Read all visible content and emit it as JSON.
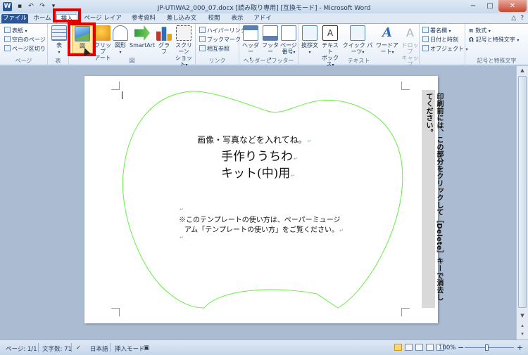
{
  "window": {
    "title": "JP-UTIWA2_000_07.docx [読み取り専用] [互換モード] - Microsoft Word",
    "app_icon": "W",
    "min": "−",
    "max": "□",
    "close": "✕"
  },
  "tabs": [
    {
      "label": "ファイル"
    },
    {
      "label": "ホーム"
    },
    {
      "label": "挿入"
    },
    {
      "label": "ページ レイアウト"
    },
    {
      "label": "参考資料"
    },
    {
      "label": "差し込み文書"
    },
    {
      "label": "校閲"
    },
    {
      "label": "表示"
    },
    {
      "label": "アドイン"
    }
  ],
  "ribbon": {
    "page_group": {
      "label": "ページ",
      "cover": "表紙",
      "blank": "空白のページ",
      "break": "ページ区切り"
    },
    "table_group": {
      "label": "表",
      "table": "表"
    },
    "figure_group": {
      "label": "図",
      "picture": "図",
      "clipart_1": "クリップ",
      "clipart_2": "アート",
      "shapes": "図形",
      "smartart": "SmartArt",
      "chart": "グラフ",
      "screenshot_1": "スクリーン",
      "screenshot_2": "ショット"
    },
    "link_group": {
      "label": "リンク",
      "hyperlink": "ハイパーリンク",
      "bookmark": "ブックマーク",
      "crossref": "相互参照"
    },
    "header_group": {
      "label": "ヘッダーとフッター",
      "header": "ヘッダー",
      "footer": "フッター",
      "pagenum_1": "ページ",
      "pagenum_2": "番号"
    },
    "text_group": {
      "label": "テキスト",
      "comment_1": "挨拶文",
      "textbox_1": "テキスト",
      "textbox_2": "ボックス",
      "quickparts": "クイック パーツ",
      "wordart": "ワードアート",
      "dropcap_1": "ドロップ",
      "dropcap_2": "キャップ",
      "signature": "署名欄",
      "datetime": "日付と時刻",
      "object": "オブジェクト"
    },
    "symbol_group": {
      "label": "記号と特殊文字",
      "equation": "数式",
      "symbol": "記号と特殊文字"
    }
  },
  "document": {
    "line1": "画像・写真などを入れてね。",
    "line2": "手作りうちわ",
    "line3": "キット(中)用",
    "note1": "※このテンプレートの使い方は、ペーパーミュージ",
    "note2": "アム「テンプレートの使い方」をご覧ください。",
    "side_note": "印刷前には、この部分をクリックして［Delete］キーで消去してください。",
    "para_mark": "↵",
    "outline_color": "#66ee44"
  },
  "status": {
    "page": "ページ: 1/1",
    "words": "文字数: 71",
    "language": "日本語",
    "mode": "挿入モード",
    "zoom": "100%",
    "minus": "−",
    "plus": "+"
  }
}
